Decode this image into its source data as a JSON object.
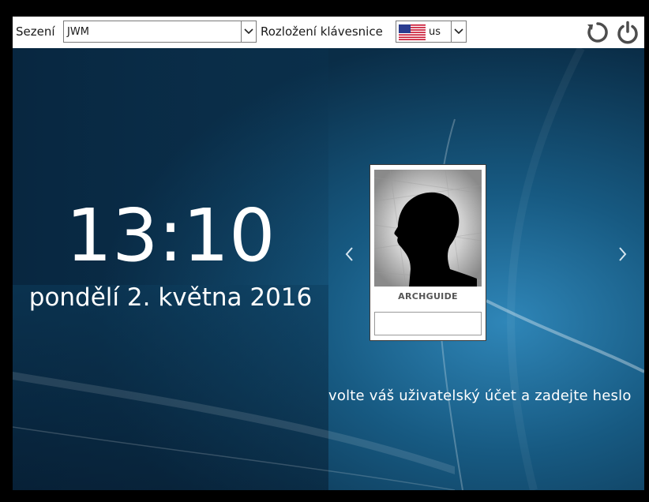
{
  "topbar": {
    "session_label": "Sezení",
    "session_value": "JWM",
    "keyboard_label": "Rozložení klávesnice",
    "keyboard_value": "us"
  },
  "clock": {
    "time": "13:10",
    "date": "pondělí 2. května 2016"
  },
  "user": {
    "name": "ARCHGUIDE",
    "password_value": ""
  },
  "hint": "volte váš uživatelský účet a zadejte heslo",
  "icons": {
    "restart": "restart-icon",
    "shutdown": "power-icon",
    "flag": "us-flag-icon",
    "prev": "chevron-left-icon",
    "next": "chevron-right-icon"
  },
  "colors": {
    "background": "#0d3a55",
    "text": "#ffffff"
  }
}
